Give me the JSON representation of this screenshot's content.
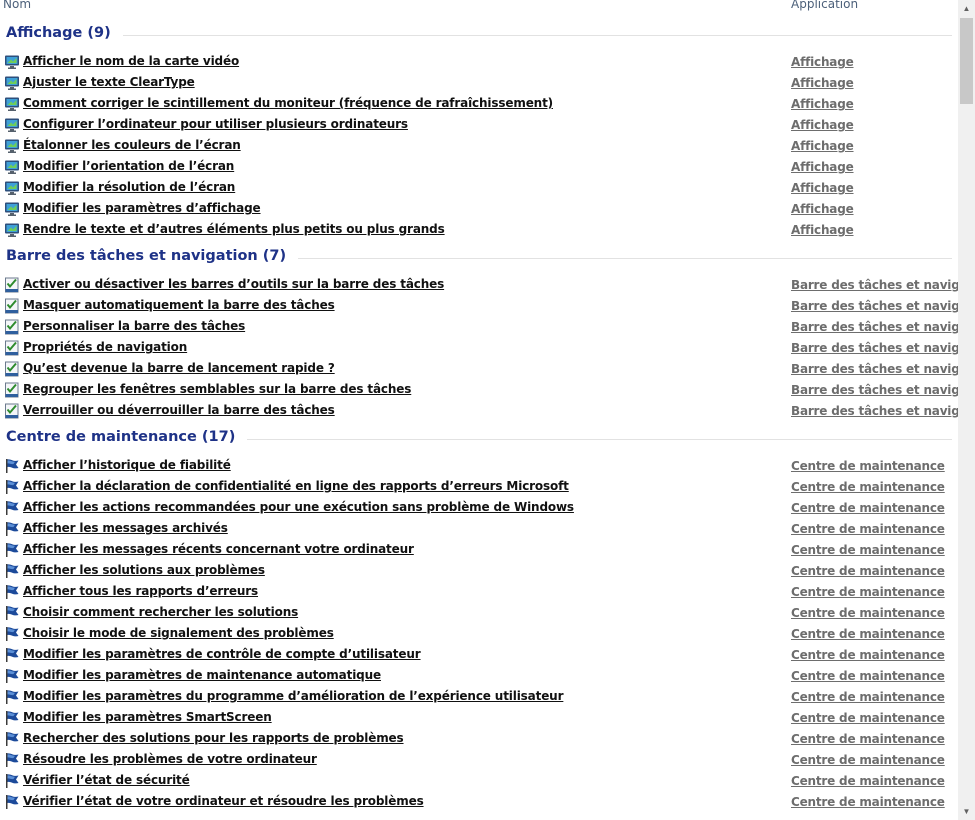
{
  "columns": {
    "nom": "Nom",
    "application": "Application"
  },
  "colors": {
    "group_title": "#1e3287",
    "link": "#111111",
    "app_link": "#6d6d6d"
  },
  "groups": [
    {
      "title": "Affichage (9)",
      "icon": "monitor-icon",
      "items": [
        {
          "name": "Afficher le nom de la carte vidéo",
          "app": "Affichage"
        },
        {
          "name": "Ajuster le texte ClearType",
          "app": "Affichage"
        },
        {
          "name": "Comment corriger le scintillement du moniteur (fréquence de rafraîchissement)",
          "app": "Affichage"
        },
        {
          "name": "Configurer l’ordinateur pour utiliser plusieurs ordinateurs",
          "app": "Affichage"
        },
        {
          "name": "Étalonner les couleurs de l’écran",
          "app": "Affichage"
        },
        {
          "name": "Modifier l’orientation de l’écran",
          "app": "Affichage"
        },
        {
          "name": "Modifier la résolution de l’écran",
          "app": "Affichage"
        },
        {
          "name": "Modifier les paramètres d’affichage",
          "app": "Affichage"
        },
        {
          "name": "Rendre le texte et d’autres éléments plus petits ou plus grands",
          "app": "Affichage"
        }
      ]
    },
    {
      "title": "Barre des tâches et navigation (7)",
      "icon": "taskbar-checklist-icon",
      "items": [
        {
          "name": "Activer ou désactiver les barres d’outils sur la barre des tâches",
          "app": "Barre des tâches et navigation"
        },
        {
          "name": "Masquer automatiquement la barre des tâches",
          "app": "Barre des tâches et navigation"
        },
        {
          "name": "Personnaliser la barre des tâches",
          "app": "Barre des tâches et navigation"
        },
        {
          "name": "Propriétés de navigation",
          "app": "Barre des tâches et navigation"
        },
        {
          "name": "Qu’est devenue la barre de lancement rapide ?",
          "app": "Barre des tâches et navigation"
        },
        {
          "name": "Regrouper les fenêtres semblables sur la barre des tâches",
          "app": "Barre des tâches et navigation"
        },
        {
          "name": "Verrouiller ou déverrouiller la barre des tâches",
          "app": "Barre des tâches et navigation"
        }
      ]
    },
    {
      "title": "Centre de maintenance (17)",
      "icon": "flag-icon",
      "items": [
        {
          "name": "Afficher l’historique de fiabilité",
          "app": "Centre de maintenance"
        },
        {
          "name": "Afficher la déclaration de confidentialité en ligne des rapports d’erreurs Microsoft",
          "app": "Centre de maintenance"
        },
        {
          "name": "Afficher les actions recommandées pour une exécution sans problème de Windows",
          "app": "Centre de maintenance"
        },
        {
          "name": "Afficher les messages archivés",
          "app": "Centre de maintenance"
        },
        {
          "name": "Afficher les messages récents concernant votre ordinateur",
          "app": "Centre de maintenance"
        },
        {
          "name": "Afficher les solutions aux problèmes",
          "app": "Centre de maintenance"
        },
        {
          "name": "Afficher tous les rapports d’erreurs",
          "app": "Centre de maintenance"
        },
        {
          "name": "Choisir comment rechercher les solutions",
          "app": "Centre de maintenance"
        },
        {
          "name": "Choisir le mode de signalement des problèmes",
          "app": "Centre de maintenance"
        },
        {
          "name": "Modifier les paramètres de contrôle de compte d’utilisateur",
          "app": "Centre de maintenance"
        },
        {
          "name": "Modifier les paramètres de maintenance automatique",
          "app": "Centre de maintenance"
        },
        {
          "name": "Modifier les paramètres du programme d’amélioration de l’expérience utilisateur",
          "app": "Centre de maintenance"
        },
        {
          "name": "Modifier les paramètres SmartScreen",
          "app": "Centre de maintenance"
        },
        {
          "name": "Rechercher des solutions pour les rapports de problèmes",
          "app": "Centre de maintenance"
        },
        {
          "name": "Résoudre les problèmes de votre ordinateur",
          "app": "Centre de maintenance"
        },
        {
          "name": "Vérifier l’état de sécurité",
          "app": "Centre de maintenance"
        },
        {
          "name": "Vérifier l’état de votre ordinateur et résoudre les problèmes",
          "app": "Centre de maintenance"
        }
      ]
    }
  ]
}
